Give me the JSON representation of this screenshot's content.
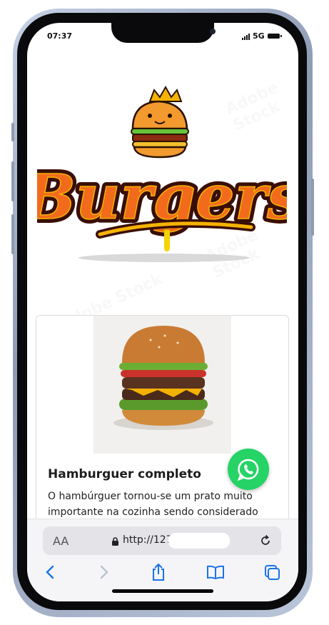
{
  "status_bar": {
    "time": "07:37",
    "network": "5G"
  },
  "logo": {
    "text": "Burgers"
  },
  "card": {
    "title": "Hamburguer completo",
    "description": "O hambúrguer tornou-se um prato muito importante na cozinha sendo considerado"
  },
  "browser": {
    "text_size_label": "AA",
    "url": "http://127"
  },
  "icons": {
    "whatsapp": "whatsapp-icon",
    "lock": "lock-icon",
    "reload": "reload-icon",
    "back": "back-chevron-icon",
    "forward": "forward-chevron-icon",
    "share": "share-icon",
    "bookmarks": "bookmarks-icon",
    "tabs": "tabs-icon"
  },
  "colors": {
    "accent_blue": "#1a73e8",
    "whatsapp_green": "#25d366",
    "logo_orange": "#f26b1d"
  }
}
